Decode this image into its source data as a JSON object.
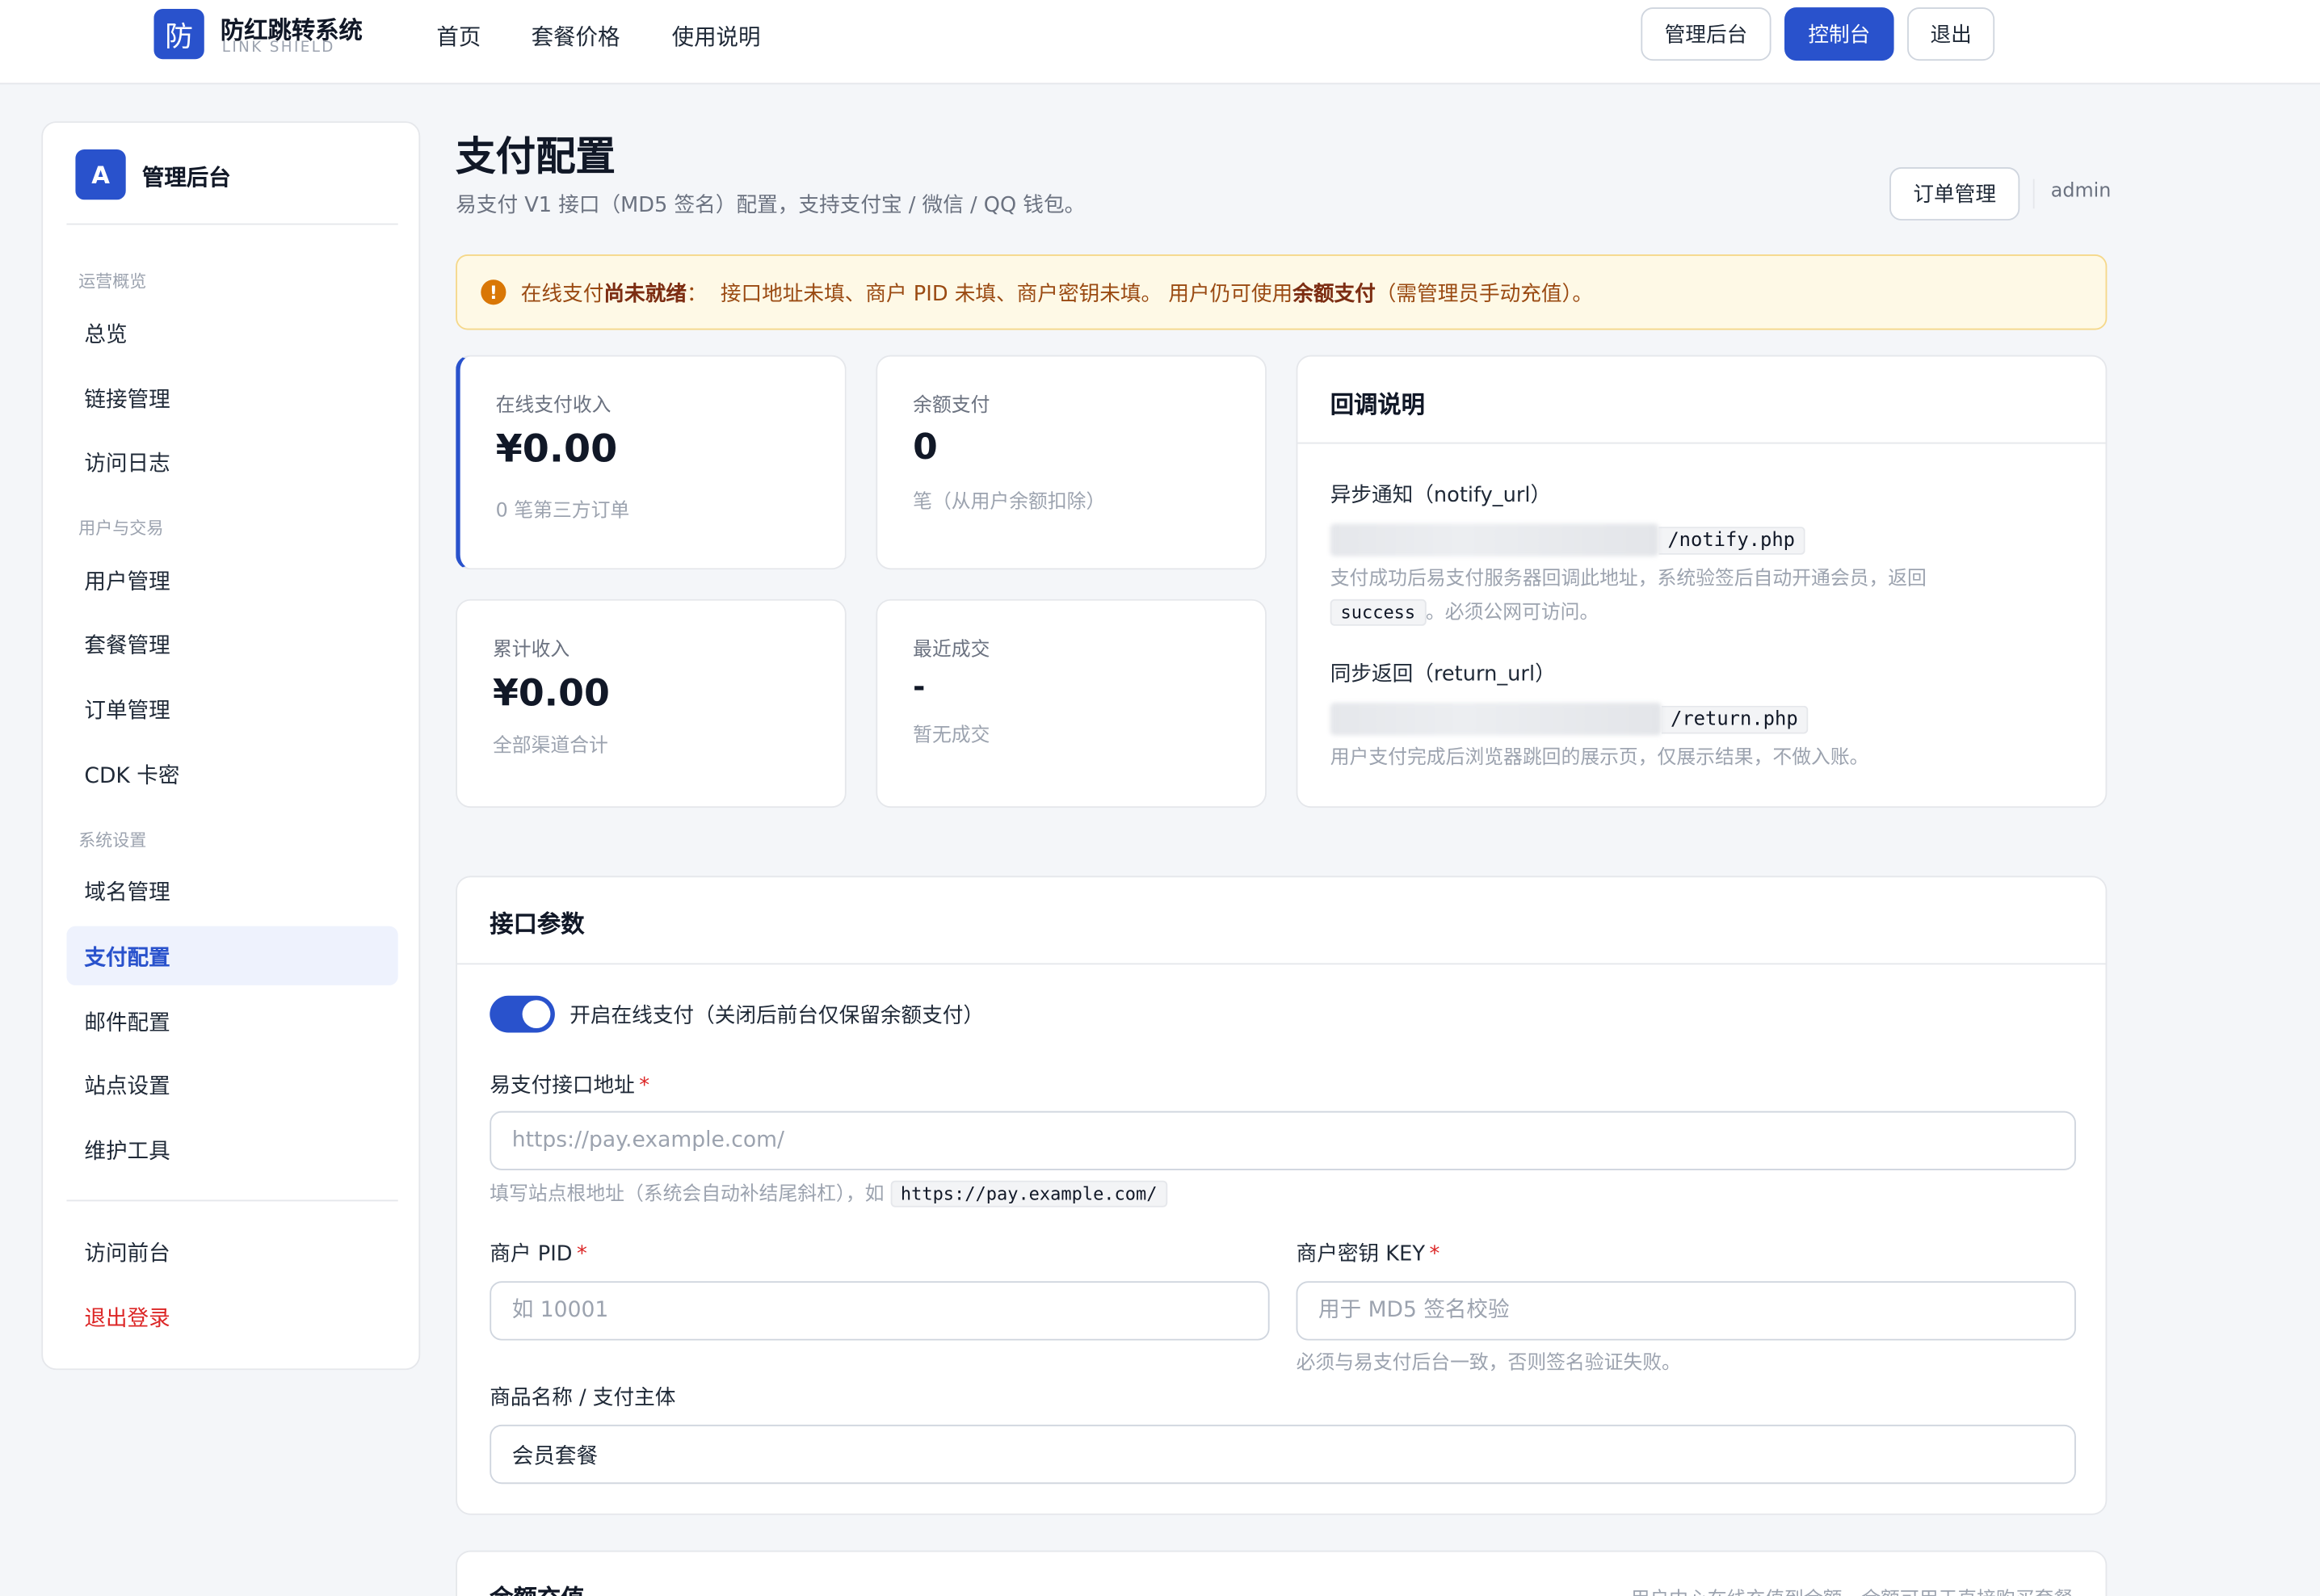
{
  "topbar": {
    "logo_char": "防",
    "brand_name": "防红跳转系统",
    "brand_sub": "LINK SHIELD",
    "nav": [
      "首页",
      "套餐价格",
      "使用说明"
    ],
    "btn_admin": "管理后台",
    "btn_console": "控制台",
    "btn_logout": "退出",
    "accent_color": "#2952cc"
  },
  "sidebar": {
    "avatar": "A",
    "title": "管理后台",
    "group1": "运营概览",
    "item_overview": "总览",
    "item_links": "链接管理",
    "item_logs": "访问日志",
    "group2": "用户与交易",
    "item_users": "用户管理",
    "item_plans": "套餐管理",
    "item_orders": "订单管理",
    "item_cdk": "CDK 卡密",
    "group3": "系统设置",
    "item_domains": "域名管理",
    "item_payment": "支付配置",
    "item_mail": "邮件配置",
    "item_site": "站点设置",
    "item_tools": "维护工具",
    "item_frontend": "访问前台",
    "item_signout": "退出登录"
  },
  "header": {
    "title": "支付配置",
    "subtitle": "易支付 V1 接口（MD5 签名）配置，支持支付宝 / 微信 / QQ 钱包。",
    "orders_btn": "订单管理",
    "user": "admin"
  },
  "alert": {
    "icon": "!",
    "p1": "在线支付",
    "b1": "尚未就绪",
    "p2": "：  接口地址未填、商户 PID 未填、商户密钥未填。 用户仍可使用",
    "b2": "余额支付",
    "p3": "（需管理员手动充值）。"
  },
  "stats": {
    "online_label": "在线支付收入",
    "online_value": "¥0.00",
    "online_note": "0 笔第三方订单",
    "balance_label": "余额支付",
    "balance_value": "0",
    "balance_note": "笔（从用户余额扣除）",
    "total_label": "累计收入",
    "total_value": "¥0.00",
    "total_note": "全部渠道合计",
    "recent_label": "最近成交",
    "recent_value": "-",
    "recent_note": "暂无成交"
  },
  "callback": {
    "title": "回调说明",
    "notify_label": "异步通知（notify_url）",
    "notify_path": "/notify.php",
    "notify_help_1": "支付成功后易支付服务器回调此地址，系统验签后自动开通会员，返回",
    "notify_code": "success",
    "notify_help_2": "。必须公网可访问。",
    "return_label": "同步返回（return_url）",
    "return_path": "/return.php",
    "return_help": "用户支付完成后浏览器跳回的展示页，仅展示结果，不做入账。"
  },
  "form": {
    "title": "接口参数",
    "toggle_label": "开启在线支付（关闭后前台仅保留余额支付）",
    "toggle_on": true,
    "api_label": "易支付接口地址",
    "api_placeholder": "https://pay.example.com/",
    "api_help": "填写站点根地址（系统会自动补结尾斜杠），如",
    "api_help_code": "https://pay.example.com/",
    "pid_label": "商户 PID",
    "pid_placeholder": "如 10001",
    "key_label": "商户密钥 KEY",
    "key_placeholder": "用于 MD5 签名校验",
    "key_help": "必须与易支付后台一致，否则签名验证失败。",
    "name_label": "商品名称 / 支付主体",
    "name_value": "会员套餐",
    "required_mark": "*"
  },
  "balance_section": {
    "title": "余额充值",
    "note": "用户中心在线充值到余额，余额可用于直接购买套餐"
  }
}
